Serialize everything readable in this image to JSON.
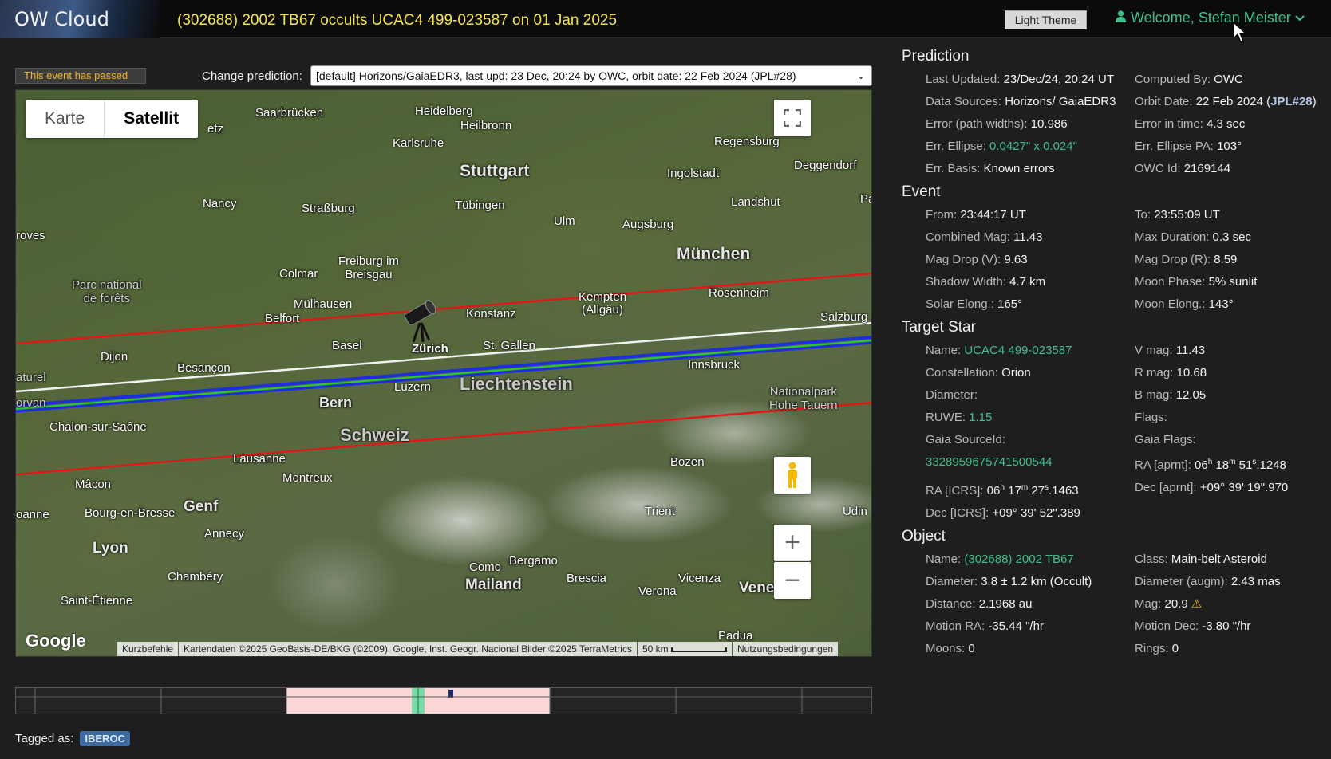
{
  "header": {
    "brand": "OW Cloud",
    "event_title": "(302688) 2002 TB67 occults UCAC4 499-023587 on 01 Jan 2025",
    "theme_button": "Light Theme",
    "welcome": "Welcome, Stefan Meister"
  },
  "controls": {
    "passed_badge": "This event has passed",
    "change_prediction_label": "Change prediction:",
    "prediction_selected": "[default] Horizons/GaiaEDR3, last upd: 23 Dec, 20:24 by OWC, orbit date: 22 Feb 2024 (JPL#28)"
  },
  "map": {
    "type_map": "Karte",
    "type_satellite": "Satellit",
    "cities": {
      "saarbruecken": "Saarbrücken",
      "heidelberg": "Heidelberg",
      "heilbronn": "Heilbronn",
      "karlsruhe": "Karlsruhe",
      "stuttgart": "Stuttgart",
      "regensburg": "Regensburg",
      "deggendorf": "Deggendorf",
      "ingolstadt": "Ingolstadt",
      "nancy": "Nancy",
      "strassburg": "Straßburg",
      "tuebingen": "Tübingen",
      "landshut": "Landshut",
      "ulm": "Ulm",
      "augsburg": "Augsburg",
      "troyes": "roves",
      "muenchen": "München",
      "freiburg": "Freiburg im\nBreisgau",
      "colmar": "Colmar",
      "parc": "Parc national\nde forêts",
      "rosenheim": "Rosenheim",
      "muelhausen": "Mülhausen",
      "kempten": "Kempten\n(Allgäu)",
      "belfort": "Belfort",
      "konstanz": "Konstanz",
      "salzburg": "Salzburg",
      "basel": "Basel",
      "zuerich": "Zürich",
      "stgallen": "St. Gallen",
      "dijon": "Dijon",
      "innsbruck": "Innsbruck",
      "liechtenstein": "Liechtenstein",
      "besancon": "Besançon",
      "naturel": "aturel",
      "morvan": "orvan",
      "bern": "Bern",
      "luzern": "Luzern",
      "nationalpark": "Nationalpark\nHohe Tauern",
      "chalon": "Chalon-sur-Saône",
      "schweiz": "Schweiz",
      "lausanne": "Lausanne",
      "bozen": "Bozen",
      "montreux": "Montreux",
      "macon": "Mâcon",
      "genf": "Genf",
      "trient": "Trient",
      "udin": "Udin",
      "roanne": "oanne",
      "bourg": "Bourg-en-Bresse",
      "annecy": "Annecy",
      "lyon": "Lyon",
      "bergamo": "Bergamo",
      "como": "Como",
      "mailand": "Mailand",
      "chambery": "Chambéry",
      "brescia": "Brescia",
      "vicenza": "Vicenza",
      "venedig": "Venedig",
      "verona": "Verona",
      "stetienne": "Saint-Étienne",
      "padua": "Padua",
      "pa": "Pa",
      "etz": "etz"
    },
    "google": "Google",
    "attrib_shortcuts": "Kurzbefehle",
    "attrib_data": "Kartendaten ©2025 GeoBasis-DE/BKG (©2009), Google, Inst. Geogr. Nacional Bilder ©2025 TerraMetrics",
    "attrib_scale": "50 km",
    "attrib_terms": "Nutzungsbedingungen"
  },
  "tags": {
    "label": "Tagged as:",
    "items": [
      "IBEROC"
    ]
  },
  "prediction": {
    "title": "Prediction",
    "last_updated_k": "Last Updated:",
    "last_updated_v": "23/Dec/24, 20:24 UT",
    "computed_by_k": "Computed By:",
    "computed_by_v": "OWC",
    "data_sources_k": "Data Sources:",
    "data_sources_v": "Horizons/ GaiaEDR3",
    "orbit_date_k": "Orbit Date:",
    "orbit_date_v": "22 Feb 2024 (",
    "orbit_jpl": "JPL#28",
    "orbit_close": ")",
    "error_time_k": "Error in time:",
    "error_time_v": "4.3 sec",
    "err_pa_k": "Err. Ellipse PA:",
    "err_pa_v": "103°",
    "error_path_k": "Error (path widths):",
    "error_path_v": "10.986",
    "owc_id_k": "OWC Id:",
    "owc_id_v": "2169144",
    "err_ellipse_k": "Err. Ellipse:",
    "err_ellipse_v": "0.0427\" x 0.024\"",
    "err_basis_k": "Err. Basis:",
    "err_basis_v": "Known errors"
  },
  "event": {
    "title": "Event",
    "from_k": "From:",
    "from_v": "23:44:17 UT",
    "to_k": "To:",
    "to_v": "23:55:09 UT",
    "comb_mag_k": "Combined Mag:",
    "comb_mag_v": "11.43",
    "max_dur_k": "Max Duration:",
    "max_dur_v": "0.3 sec",
    "mag_drop_v_k": "Mag Drop (V):",
    "mag_drop_v_v": "9.63",
    "mag_drop_r_k": "Mag Drop (R):",
    "mag_drop_r_v": "8.59",
    "shadow_k": "Shadow Width:",
    "shadow_v": "4.7 km",
    "moon_phase_k": "Moon Phase:",
    "moon_phase_v": "5% sunlit",
    "solar_k": "Solar Elong.:",
    "solar_v": "165°",
    "moon_elong_k": "Moon Elong.:",
    "moon_elong_v": "143°"
  },
  "star": {
    "title": "Target Star",
    "name_k": "Name:",
    "name_v": "UCAC4 499-023587",
    "vmag_k": "V mag:",
    "vmag_v": "11.43",
    "const_k": "Constellation:",
    "const_v": "Orion",
    "rmag_k": "R mag:",
    "rmag_v": "10.68",
    "diam_k": "Diameter:",
    "diam_v": "",
    "bmag_k": "B mag:",
    "bmag_v": "12.05",
    "ruwe_k": "RUWE:",
    "ruwe_v": "1.15",
    "flags_k": "Flags:",
    "flags_v": "",
    "gaia_k": "Gaia SourceId:",
    "gaia_v": "3328959675741500544",
    "gaia_flags_k": "Gaia Flags:",
    "ra_aprnt_k": "RA [aprnt]:",
    "ra_aprnt": [
      "06",
      "h",
      " 18",
      "m",
      " 51",
      "s",
      ".1248"
    ],
    "ra_icrs_k": "RA [ICRS]:",
    "ra_icrs": [
      "06",
      "h",
      " 17",
      "m",
      " 27",
      "s",
      ".1463"
    ],
    "dec_aprnt_k": "Dec [aprnt]:",
    "dec_aprnt_v": "+09° 39' 19\".970",
    "dec_icrs_k": "Dec [ICRS]:",
    "dec_icrs_v": "+09° 39' 52\".389"
  },
  "object": {
    "title": "Object",
    "name_k": "Name:",
    "name_v": "(302688) 2002 TB67",
    "class_k": "Class:",
    "class_v": "Main-belt Asteroid",
    "diam_k": "Diameter:",
    "diam_v": "3.8 ± 1.2 km (Occult)",
    "diam_augm_k": "Diameter (augm):",
    "diam_augm_v": "2.43 mas",
    "dist_k": "Distance:",
    "dist_v": "2.1968 au",
    "mag_k": "Mag:",
    "mag_v": "20.9",
    "mra_k": "Motion RA:",
    "mra_v": "-35.44 \"/hr",
    "mdec_k": "Motion Dec:",
    "mdec_v": "-3.80 \"/hr",
    "moons_k": "Moons:",
    "moons_v": "0",
    "rings_k": "Rings:",
    "rings_v": "0"
  }
}
